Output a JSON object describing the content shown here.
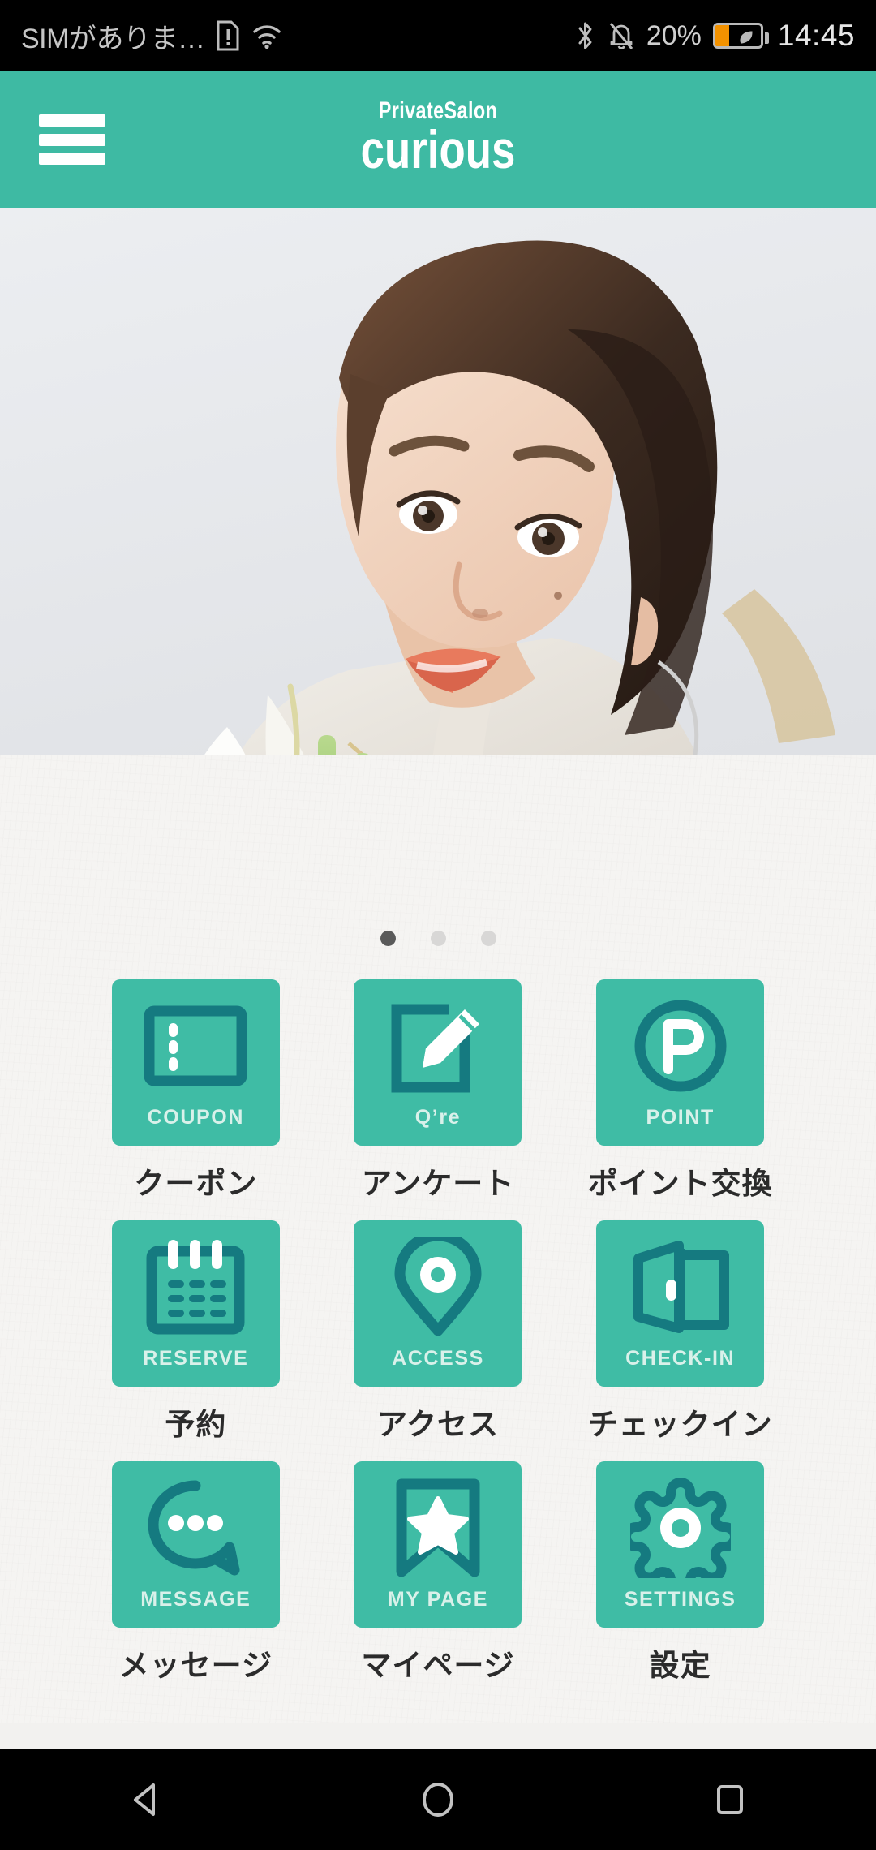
{
  "status_bar": {
    "carrier_text": "SIMがありま…",
    "sim_icon": "sim-alert-icon",
    "wifi_icon": "wifi-icon",
    "bluetooth_icon": "bluetooth-icon",
    "mute_icon": "bell-mute-icon",
    "battery_percent": "20%",
    "battery_icon": "battery-saver-icon",
    "time": "14:45"
  },
  "header": {
    "menu_icon": "hamburger-menu-icon",
    "brand_sub": "PrivateSalon",
    "brand_main": "curious",
    "bg_color": "#3ebaa3"
  },
  "hero": {
    "alt": "salon-model-photo",
    "carousel_dots": {
      "count": 3,
      "active_index": 0
    }
  },
  "colors": {
    "accent": "#3ebaa3",
    "tile": "#3fbca5",
    "icon_dark": "#157a80",
    "paper": "#f5f4f2",
    "label": "#2b2b2b",
    "caption": "#d9f1ea"
  },
  "grid": {
    "items": [
      {
        "caption": "COUPON",
        "label": "クーポン",
        "icon": "ticket-icon"
      },
      {
        "caption": "Q’re",
        "label": "アンケート",
        "icon": "edit-pencil-icon"
      },
      {
        "caption": "POINT",
        "label": "ポイント交換",
        "icon": "point-p-circle-icon"
      },
      {
        "caption": "RESERVE",
        "label": "予約",
        "icon": "calendar-icon"
      },
      {
        "caption": "ACCESS",
        "label": "アクセス",
        "icon": "map-pin-icon"
      },
      {
        "caption": "CHECK-IN",
        "label": "チェックイン",
        "icon": "open-door-icon"
      },
      {
        "caption": "MESSAGE",
        "label": "メッセージ",
        "icon": "speech-bubble-icon"
      },
      {
        "caption": "MY PAGE",
        "label": "マイページ",
        "icon": "bookmark-star-icon"
      },
      {
        "caption": "SETTINGS",
        "label": "設定",
        "icon": "gear-icon"
      }
    ]
  },
  "navigation_bar": {
    "back": "back-triangle-icon",
    "home": "home-circle-icon",
    "recents": "recents-square-icon"
  }
}
